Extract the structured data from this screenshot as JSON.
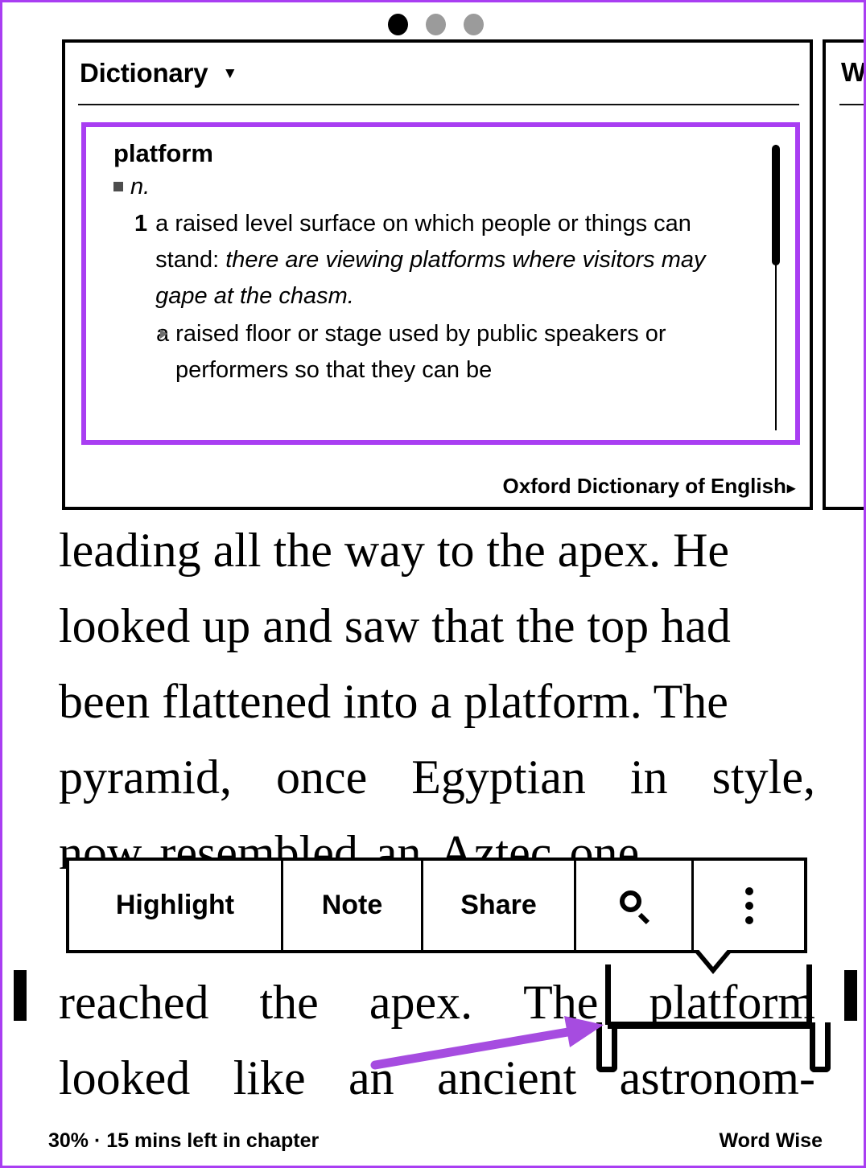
{
  "reader": {
    "page_dots": [
      "active",
      "inactive",
      "inactive"
    ],
    "accent_color": "#a93ef2",
    "card": {
      "title": "Dictionary",
      "caret": "▼",
      "entry": {
        "word": "platform",
        "part_of_speech": "n.",
        "sense_number": "1",
        "sense_text_plain": "a raised level surface on which people or things can stand:",
        "sense_example": "there are viewing platforms where visitors may gape at the chasm.",
        "subsense_text": "a raised floor or stage used by public speakers or performers so that they can be"
      },
      "source": "Oxford Dictionary of English",
      "source_caret": "▸"
    },
    "next_card": {
      "title_visible": "W"
    },
    "book_text": {
      "upper_lines": [
        "leading all the way to the apex. He",
        "looked up and saw that the top had",
        "been flattened into a platform. The"
      ],
      "upper_justified": [
        [
          "pyramid,",
          "once",
          "Egyptian",
          "in",
          "style,"
        ],
        [
          "now",
          "resembled",
          "an",
          "Aztec",
          "one."
        ]
      ],
      "lower_justified": [
        [
          "reached",
          "the",
          "apex.",
          "The",
          "platform"
        ],
        [
          "looked",
          "like",
          "an",
          "ancient",
          "astronom-"
        ]
      ],
      "selected_word": "platform"
    },
    "toolbar": {
      "highlight_label": "Highlight",
      "note_label": "Note",
      "share_label": "Share",
      "search_icon": "search-icon",
      "more_icon": "more-vertical-icon"
    },
    "footer": {
      "progress": "30% · 15 mins left in chapter",
      "word_wise": "Word Wise"
    }
  }
}
